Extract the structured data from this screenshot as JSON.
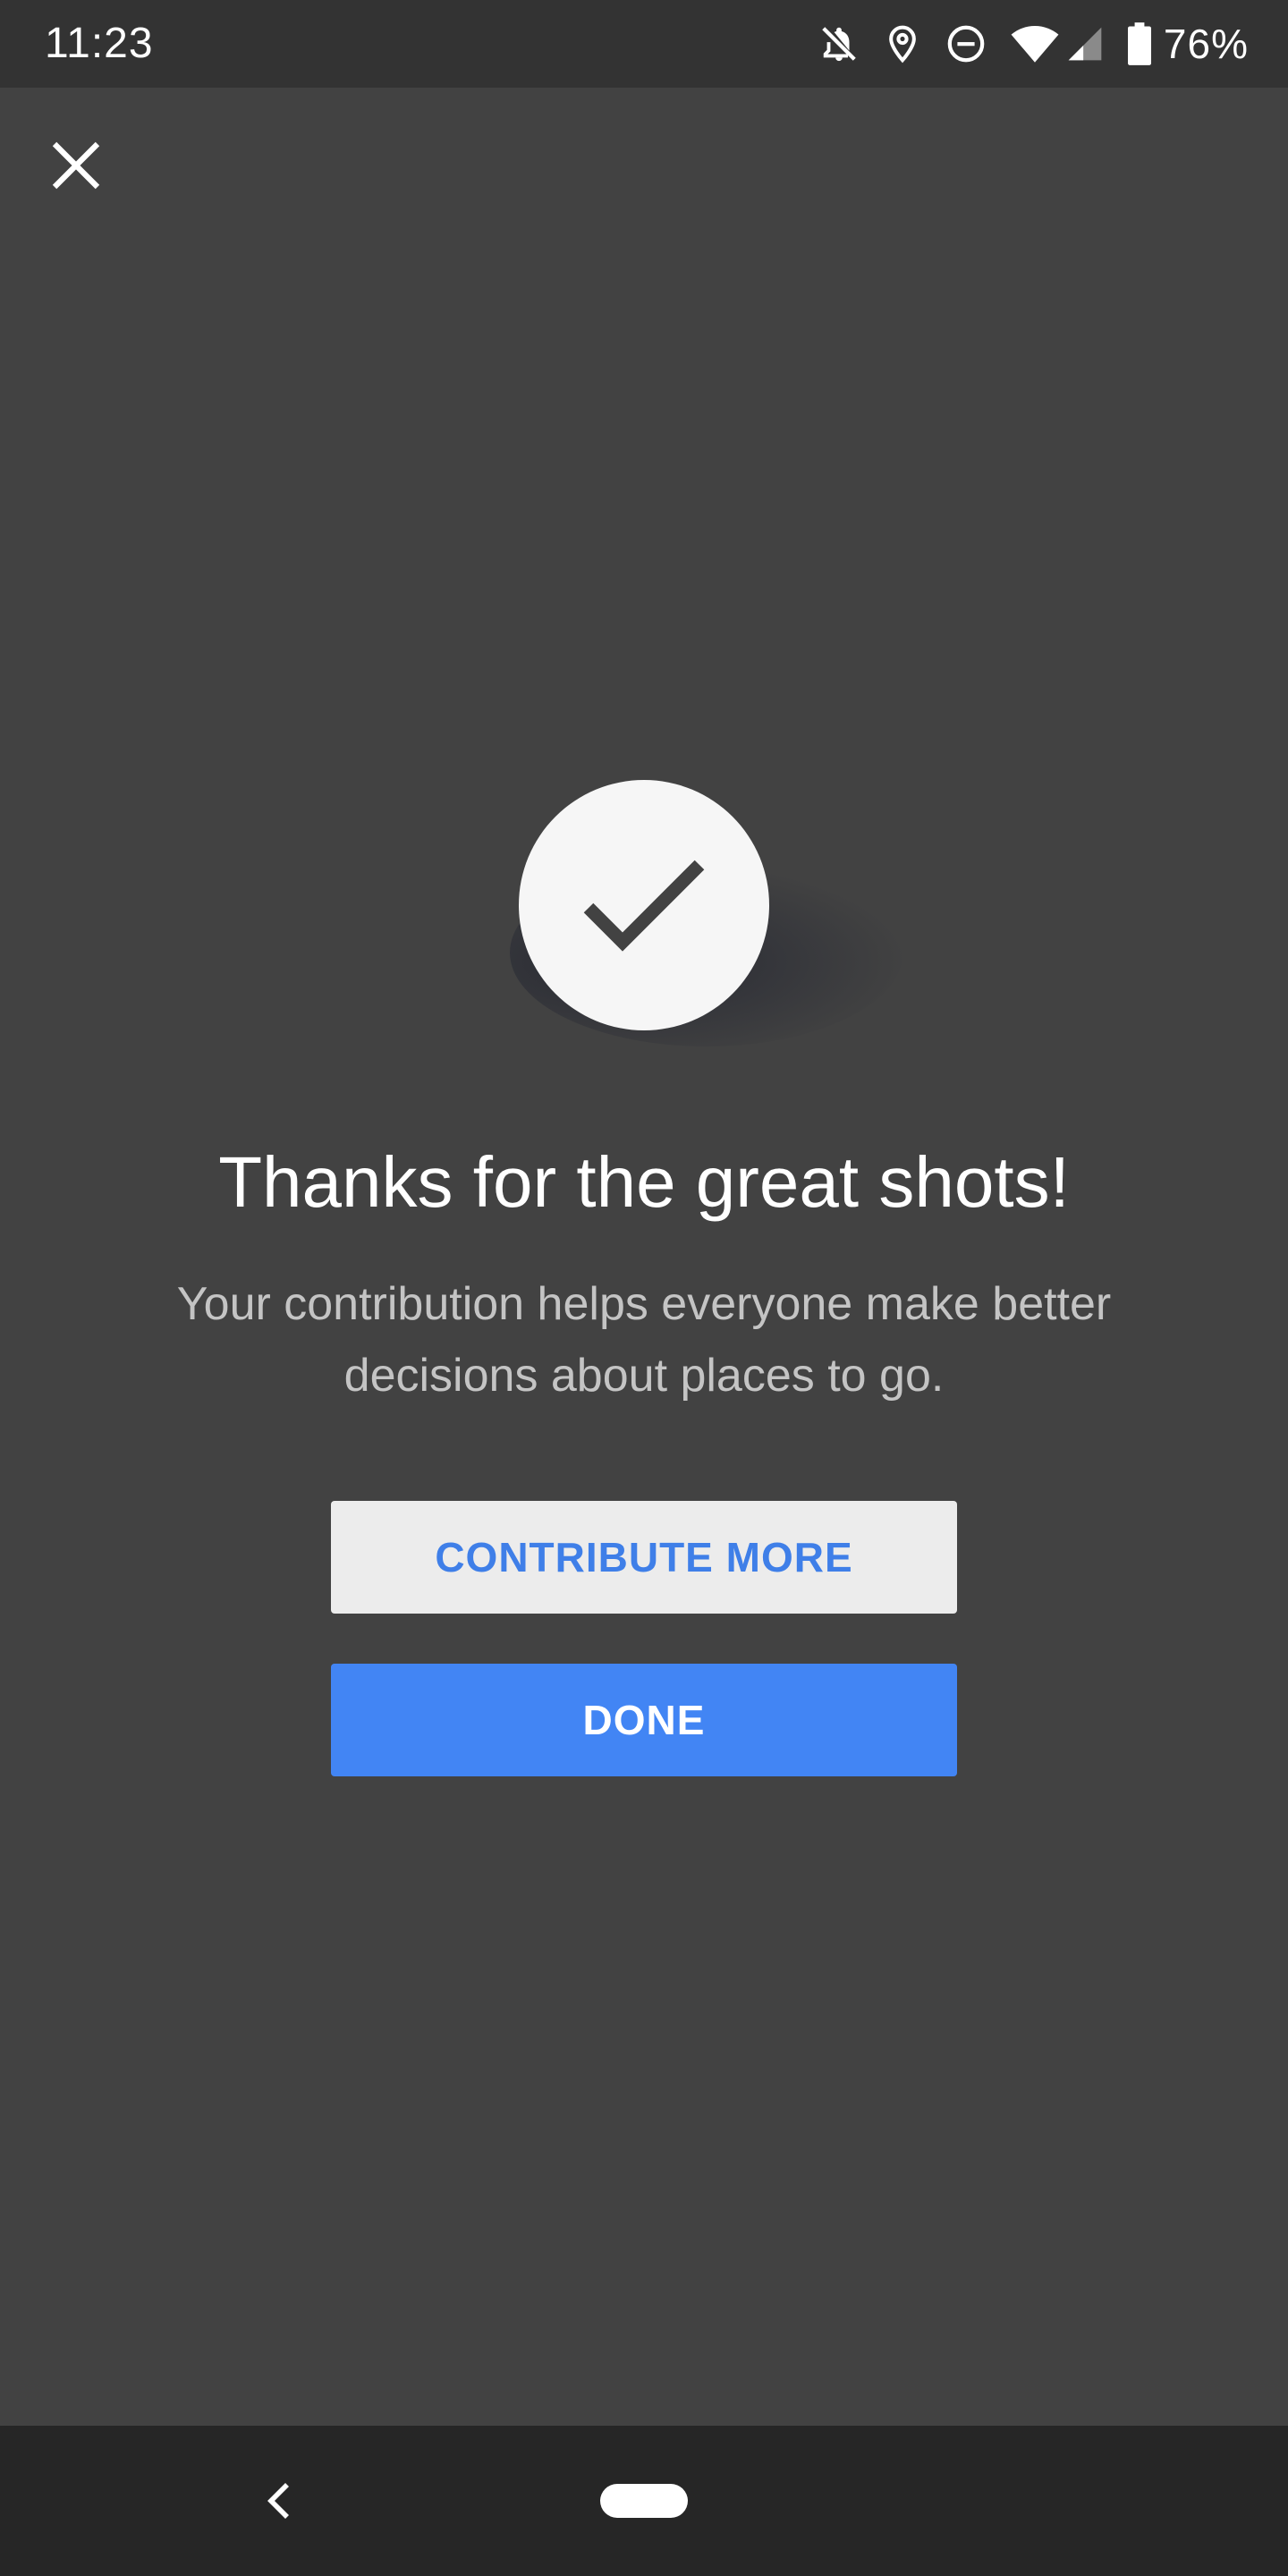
{
  "status_bar": {
    "time": "11:23",
    "battery_percent": "76%",
    "icons": [
      "notifications-off-icon",
      "location-icon",
      "do-not-disturb-icon",
      "wifi-icon",
      "cellular-signal-icon",
      "battery-icon"
    ]
  },
  "top_bar": {
    "close_icon": "close-icon"
  },
  "confirmation": {
    "icon": "check-icon",
    "title": "Thanks for the great shots!",
    "message": "Your contribution helps everyone make better decisions about places to go."
  },
  "actions": {
    "contribute_more_label": "CONTRIBUTE MORE",
    "done_label": "DONE"
  },
  "nav_bar": {
    "back_icon": "back-icon",
    "home_icon": "home-pill-icon"
  },
  "colors": {
    "background": "#424242",
    "status_bar": "#333333",
    "nav_bar": "#262626",
    "accent_blue": "#4285f4",
    "secondary_button": "#ececec",
    "subtitle_text": "#c4c4c4"
  }
}
